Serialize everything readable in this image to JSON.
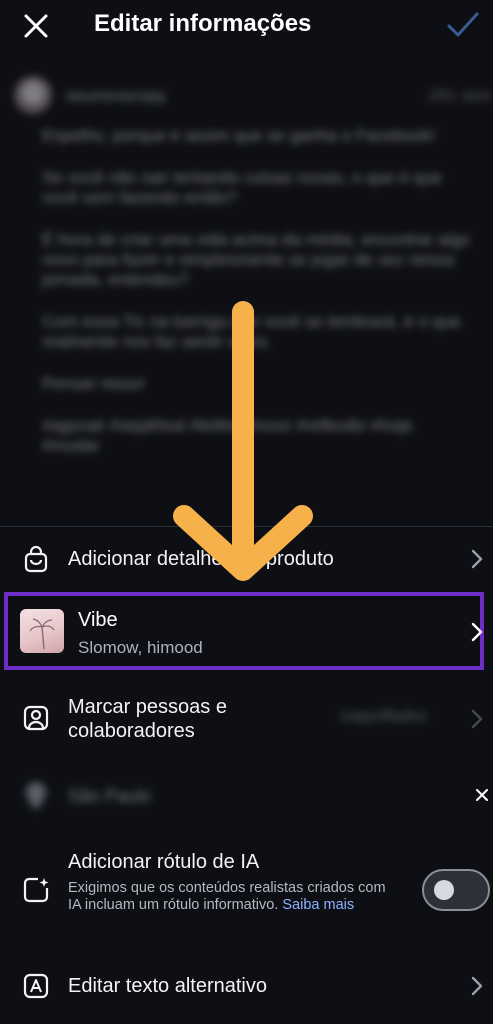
{
  "header": {
    "title": "Editar informações",
    "close_icon": "close-icon",
    "confirm_icon": "check-icon"
  },
  "caption": {
    "username": "seunovocopy",
    "count": "281 sem",
    "paragraphs": [
      "Espelho, porque é assim que se ganha o Facebook!",
      "Se você não sair tentando coisas novas, o que é que você vem fazendo então?",
      "É hora de criar uma vida acima da média, encontrar algo novo para fazer e simplesmente se jogar de vez nessa jornada, entendeu?",
      "Com essa Tic na barriga que você se lembrará, é o que realmente nos faz sentir vivos.",
      "Pensar nisso!",
      "#agoraé #sejaReal #brilhe #novo #reflexão #hoje #mudar"
    ]
  },
  "rows": {
    "product": {
      "label": "Adicionar detalhes do produto"
    },
    "vibe": {
      "title": "Vibe",
      "subtitle": "Slomow, himood"
    },
    "people": {
      "label_line1": "Marcar pessoas e",
      "label_line2": "colaboradores",
      "value": "copyoffadoo"
    },
    "location": {
      "label": "São Paulo"
    },
    "ai_label": {
      "title": "Adicionar rótulo de IA",
      "description": "Exigimos que os conteúdos realistas criados com IA incluam um rótulo informativo.",
      "link": "Saiba mais",
      "toggle_on": false
    },
    "alt_text": {
      "label": "Editar texto alternativo"
    }
  },
  "colors": {
    "background": "#0d0f14",
    "highlight_border": "#6f2fc7",
    "arrow": "#f6b14a",
    "check": "#3a5a96"
  }
}
